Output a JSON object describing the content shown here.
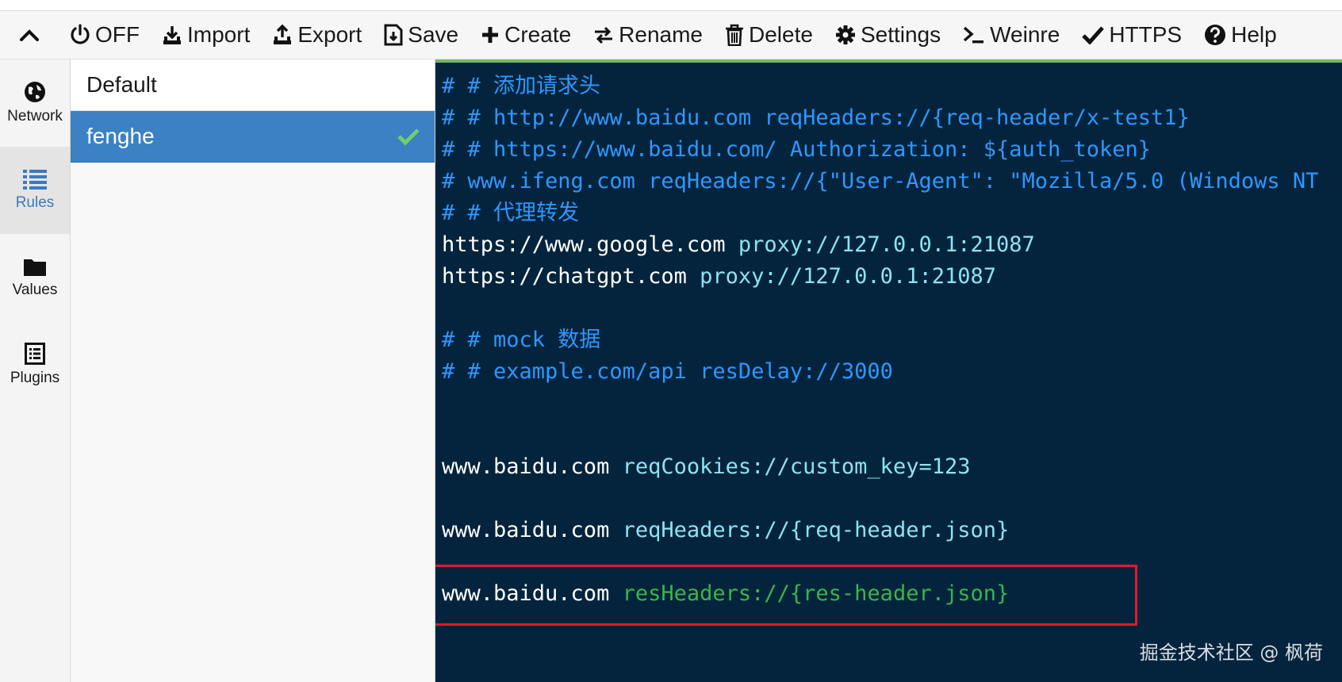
{
  "toolbar": {
    "items": [
      {
        "label": "OFF",
        "icon": "power-icon"
      },
      {
        "label": "Import",
        "icon": "import-icon"
      },
      {
        "label": "Export",
        "icon": "export-icon"
      },
      {
        "label": "Save",
        "icon": "save-icon"
      },
      {
        "label": "Create",
        "icon": "plus-icon"
      },
      {
        "label": "Rename",
        "icon": "swap-icon"
      },
      {
        "label": "Delete",
        "icon": "trash-icon"
      },
      {
        "label": "Settings",
        "icon": "gear-icon"
      },
      {
        "label": "Weinre",
        "icon": "terminal-icon"
      },
      {
        "label": "HTTPS",
        "icon": "check-icon"
      },
      {
        "label": "Help",
        "icon": "help-icon"
      }
    ]
  },
  "nav": {
    "items": [
      {
        "label": "Network",
        "icon": "globe-icon"
      },
      {
        "label": "Rules",
        "icon": "list-icon",
        "active": true
      },
      {
        "label": "Values",
        "icon": "folder-icon"
      },
      {
        "label": "Plugins",
        "icon": "plugin-icon"
      }
    ]
  },
  "rules": {
    "items": [
      {
        "name": "Default"
      },
      {
        "name": "fenghe",
        "selected": true
      }
    ]
  },
  "editor": {
    "lines": [
      [
        {
          "t": "# # 添加请求头",
          "c": "comment"
        }
      ],
      [
        {
          "t": "# # http://www.baidu.com reqHeaders://{req-header/x-test1}",
          "c": "comment"
        }
      ],
      [
        {
          "t": "# # https://www.baidu.com/ Authorization: ${auth_token}",
          "c": "comment"
        }
      ],
      [
        {
          "t": "# www.ifeng.com reqHeaders://{\"User-Agent\": \"Mozilla/5.0 (Windows NT",
          "c": "comment"
        }
      ],
      [
        {
          "t": "# # 代理转发",
          "c": "comment"
        }
      ],
      [
        {
          "t": "https://www.google.com ",
          "c": "host"
        },
        {
          "t": "proxy://127.0.0.1:21087",
          "c": "proto"
        }
      ],
      [
        {
          "t": "https://chatgpt.com ",
          "c": "host"
        },
        {
          "t": "proxy://127.0.0.1:21087",
          "c": "proto"
        }
      ],
      [],
      [
        {
          "t": "# # mock 数据",
          "c": "comment"
        }
      ],
      [
        {
          "t": "# # example.com/api resDelay://3000",
          "c": "comment"
        }
      ],
      [],
      [],
      [
        {
          "t": "www.baidu.com ",
          "c": "host"
        },
        {
          "t": "reqCookies://custom_key=123",
          "c": "proto"
        }
      ],
      [],
      [
        {
          "t": "www.baidu.com ",
          "c": "host"
        },
        {
          "t": "reqHeaders://{req-header.json}",
          "c": "proto"
        }
      ],
      [],
      [
        {
          "t": "www.baidu.com ",
          "c": "host"
        },
        {
          "t": "resHeaders://{res-header.json}",
          "c": "green"
        }
      ]
    ],
    "watermark": "掘金技术社区 @ 枫荷"
  },
  "colors": {
    "editor_bg": "#04243d",
    "comment": "#2f97ff",
    "protocol": "#8de3f2",
    "highlight_protocol": "#39b54a",
    "selected_rule": "#3a82c4",
    "highlight_border": "#e0192c"
  }
}
